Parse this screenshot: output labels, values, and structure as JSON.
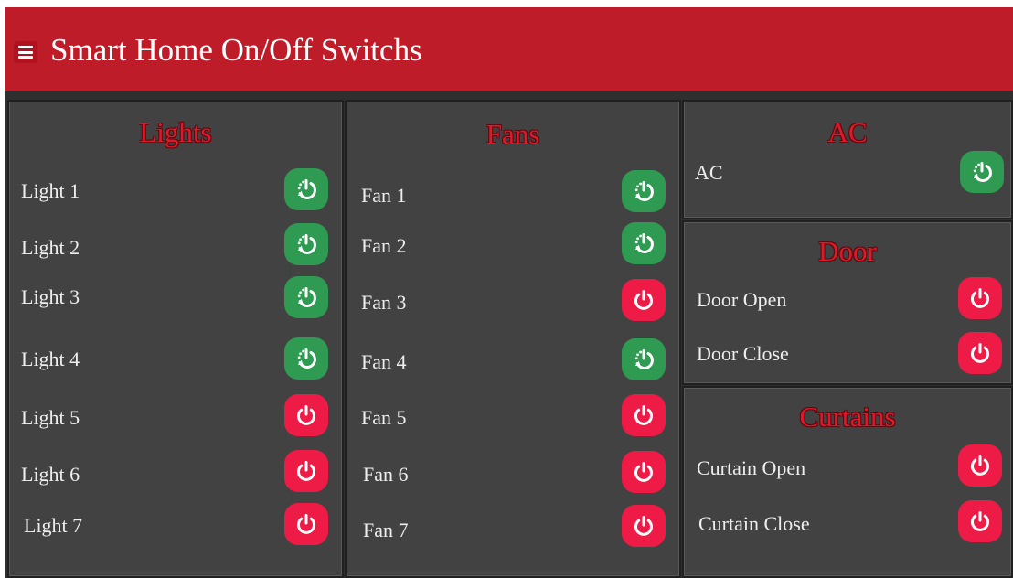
{
  "header": {
    "title": "Smart Home On/Off Switchs"
  },
  "colors": {
    "header_bg": "#bf1c29",
    "panel_bg": "#424242",
    "on": "#2e9a52",
    "off": "#ee1b47",
    "section_title": "#e01828"
  },
  "icons": {
    "menu": "hamburger-icon",
    "switch_on": "power-restart-icon",
    "switch_off": "power-icon"
  },
  "lights": {
    "title": "Lights",
    "items": [
      {
        "label": "Light 1",
        "state": "on"
      },
      {
        "label": "Light 2",
        "state": "on"
      },
      {
        "label": "Light 3",
        "state": "on"
      },
      {
        "label": "Light 4",
        "state": "on"
      },
      {
        "label": "Light 5",
        "state": "off"
      },
      {
        "label": "Light 6",
        "state": "off"
      },
      {
        "label": "Light 7",
        "state": "off"
      }
    ]
  },
  "fans": {
    "title": "Fans",
    "items": [
      {
        "label": "Fan 1",
        "state": "on"
      },
      {
        "label": "Fan 2",
        "state": "on"
      },
      {
        "label": "Fan 3",
        "state": "off"
      },
      {
        "label": "Fan 4",
        "state": "on"
      },
      {
        "label": "Fan 5",
        "state": "off"
      },
      {
        "label": "Fan 6",
        "state": "off"
      },
      {
        "label": "Fan 7",
        "state": "off"
      }
    ]
  },
  "ac": {
    "title": "AC",
    "items": [
      {
        "label": "AC",
        "state": "on"
      }
    ]
  },
  "door": {
    "title": "Door",
    "items": [
      {
        "label": "Door Open",
        "state": "off"
      },
      {
        "label": "Door Close",
        "state": "off"
      }
    ]
  },
  "curtains": {
    "title": "Curtains",
    "items": [
      {
        "label": "Curtain Open",
        "state": "off"
      },
      {
        "label": "Curtain Close",
        "state": "off"
      }
    ]
  }
}
